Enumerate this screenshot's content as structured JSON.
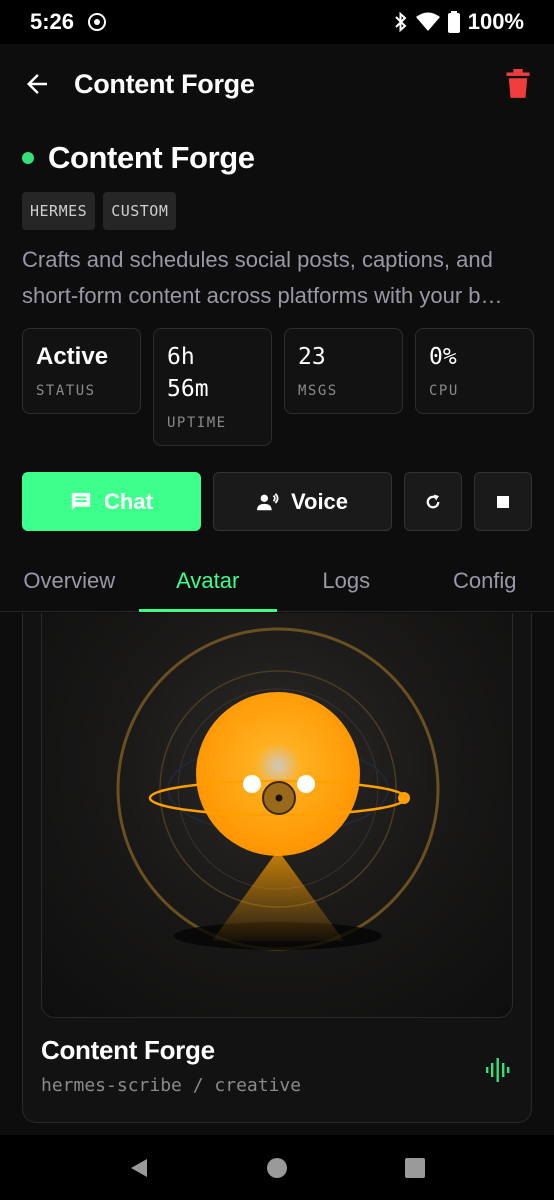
{
  "status_bar": {
    "time": "5:26",
    "battery": "100%"
  },
  "app_bar": {
    "title": "Content Forge",
    "back_icon": "arrow-left-icon",
    "delete_icon": "trash-icon"
  },
  "agent": {
    "name": "Content Forge",
    "status_color": "#34e07a",
    "tags": [
      "HERMES",
      "CUSTOM"
    ],
    "description_lines": [
      "Crafts and schedules social posts, captions, and",
      "short-form content across platforms with your b…"
    ]
  },
  "stats": [
    {
      "value_line1": "Active",
      "value_line2": "",
      "label": "STATUS"
    },
    {
      "value_line1": "6h",
      "value_line2": "56m",
      "label": "UPTIME"
    },
    {
      "value_line1": "23",
      "value_line2": "",
      "label": "MSGS"
    },
    {
      "value_line1": "0%",
      "value_line2": "",
      "label": "CPU"
    }
  ],
  "actions": {
    "chat_label": "Chat",
    "voice_label": "Voice",
    "restart_icon": "refresh-icon",
    "stop_icon": "stop-icon"
  },
  "tabs": [
    {
      "label": "Overview",
      "active": false
    },
    {
      "label": "Avatar",
      "active": true
    },
    {
      "label": "Logs",
      "active": false
    },
    {
      "label": "Config",
      "active": false
    }
  ],
  "avatar_card": {
    "name": "Content Forge",
    "subtitle": "hermes-scribe / creative",
    "accent_color": "#ffa000",
    "wave_icon": "audio-wave-icon"
  },
  "colors": {
    "accent": "#3dff8c",
    "danger": "#f03c3c",
    "background": "#0d0d0d"
  }
}
